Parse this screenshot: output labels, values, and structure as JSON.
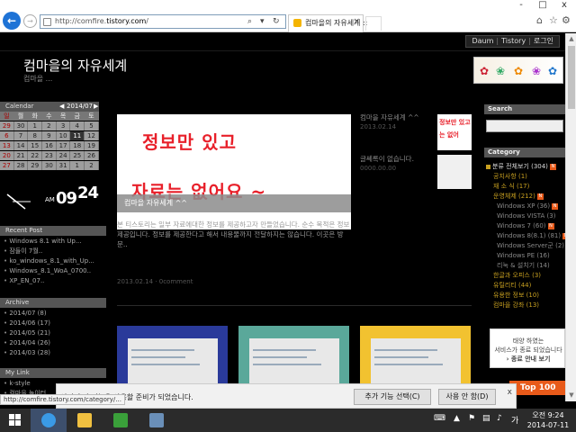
{
  "browser": {
    "url_prefix": "http://comfire.",
    "url_domain": "tistory.com",
    "url_suffix": "/",
    "tab_title": "컴마을의 자유세계 ::",
    "window_controls": [
      "-",
      "□",
      "x"
    ],
    "right_icons": [
      "⌂",
      "☆",
      "⚙"
    ]
  },
  "blog": {
    "top_links": [
      "Daum",
      "Tistory",
      "로그인"
    ],
    "title": "컴마을의 자유세계",
    "subtitle": "컴마을 ..."
  },
  "calendar": {
    "label": "Calendar",
    "month": "2014/07",
    "headers": [
      "일",
      "월",
      "화",
      "수",
      "목",
      "금",
      "토"
    ],
    "rows": [
      [
        "29",
        "30",
        "1",
        "2",
        "3",
        "4",
        "5"
      ],
      [
        "6",
        "7",
        "8",
        "9",
        "10",
        "11",
        "12"
      ],
      [
        "13",
        "14",
        "15",
        "16",
        "17",
        "18",
        "19"
      ],
      [
        "20",
        "21",
        "22",
        "23",
        "24",
        "25",
        "26"
      ],
      [
        "27",
        "28",
        "29",
        "30",
        "31",
        "1",
        "2"
      ]
    ]
  },
  "clock": {
    "ampm": "AM",
    "hour": "09",
    "minute": "24"
  },
  "recent_post": {
    "label": "Recent Post",
    "items": [
      "Windows 8.1 with Up...",
      "잠들이 7월..",
      "ko_windows_8.1_with_Up...",
      "Windows_8.1_WoA_0700..",
      "XP_EN_07.."
    ]
  },
  "archive": {
    "label": "Archive",
    "items": [
      "2014/07 (8)",
      "2014/06 (17)",
      "2014/05 (21)",
      "2014/04 (26)",
      "2014/03 (28)"
    ]
  },
  "mylink": {
    "label": "My Link",
    "items": [
      "k-style",
      "컴마을 놀이터"
    ]
  },
  "post": {
    "image_line1": "정보만 있고",
    "image_line2": "자료는 없어요 ~",
    "caption": "컴마을 자유세계 ^^",
    "text": "본 티스토리는 일부 자료에대한 정보를 제공하고자 만들었습니다. 순수 목적은 정보 제공입니다. 정보를 제공한다고 해서 내용물까지 전달하지는 않습니다. 이곳은 방문..",
    "meta": "2013.02.14 · 0comment"
  },
  "side_posts": [
    {
      "title": "컴마을 자유세계 ^^",
      "date": "2013.02.14"
    },
    {
      "title": "글쎄록이 없습니다.",
      "date": "0000.00.00"
    }
  ],
  "mini_thumb": {
    "line1": "정보만 있고",
    "line2": "는 없어"
  },
  "search": {
    "label": "Search"
  },
  "category": {
    "label": "Category",
    "items": [
      {
        "label": "분류 전체보기 (304)",
        "kind": "top",
        "new": true
      },
      {
        "label": "공지사항 (1)",
        "kind": "child",
        "new": false
      },
      {
        "label": "재 소 식 (17)",
        "kind": "child",
        "new": false
      },
      {
        "label": "운영체제 (212)",
        "kind": "child",
        "new": true
      },
      {
        "label": "Windows XP (36)",
        "kind": "sub",
        "new": true
      },
      {
        "label": "Windows VISTA (3)",
        "kind": "sub",
        "new": false
      },
      {
        "label": "Windows 7 (60)",
        "kind": "sub",
        "new": true
      },
      {
        "label": "Windows 8(8.1) (81)",
        "kind": "sub",
        "new": true
      },
      {
        "label": "Windows Server군 (2)",
        "kind": "sub",
        "new": true
      },
      {
        "label": "Windows PE (16)",
        "kind": "sub",
        "new": false
      },
      {
        "label": "리눅 & 설치기 (14)",
        "kind": "sub",
        "new": false
      },
      {
        "label": "한글과 오피스 (3)",
        "kind": "child",
        "new": false
      },
      {
        "label": "유틸리티 (44)",
        "kind": "child",
        "new": false
      },
      {
        "label": "유용한 정보 (10)",
        "kind": "child",
        "new": false
      },
      {
        "label": "컴마을 강좌 (13)",
        "kind": "child",
        "new": false
      }
    ]
  },
  "ad": {
    "line1": "태양 하였는",
    "line2": "서비스가 종료 되었습니다",
    "line3": "› 종료 안내 보기"
  },
  "top100": "Top 100",
  "notification": {
    "message": "이미 추가 기능을 사용할 준비가 되었습니다.",
    "btn_select": "추가 기능 선택(C)",
    "btn_no": "사용 안 함(D)",
    "close": "x"
  },
  "status_url": "http://comfire.tistory.com/category/...",
  "taskbar": {
    "time": "오전 9:24",
    "date": "2014-07-11"
  },
  "colors": {
    "ie_blue": "#1e73d6",
    "post_red": "#e8202a",
    "badge_orange": "#e85a1a",
    "category_gold": "#c8a020"
  }
}
